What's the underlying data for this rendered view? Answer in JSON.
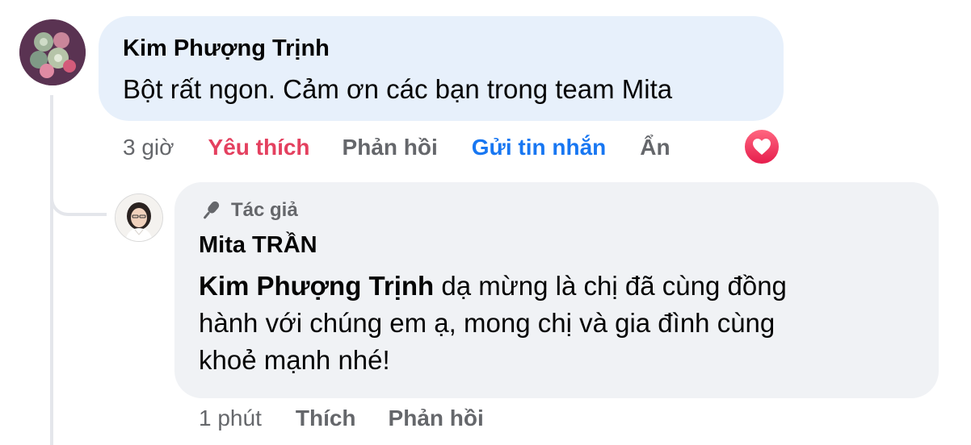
{
  "comment": {
    "author": "Kim Phượng Trịnh",
    "text": "Bột rất ngon. Cảm ơn các bạn trong team Mita",
    "time": "3 giờ",
    "actions": {
      "like": "Yêu thích",
      "reply": "Phản hồi",
      "message": "Gửi tin nhắn",
      "hide": "Ẩn"
    },
    "reaction_icon": "heart-icon",
    "colors": {
      "like": "#e4405f",
      "message": "#1877f2",
      "bubble": "#e7f0fb"
    }
  },
  "reply": {
    "badge": "Tác giả",
    "badge_icon": "microphone-icon",
    "author": "Mita TRẦN",
    "mention": "Kim Phượng Trịnh",
    "text_line1": " dạ mừng là chị đã cùng đồng",
    "text_line2": "hành với chúng em ạ, mong chị và gia đình cùng",
    "text_line3": "khoẻ mạnh nhé!",
    "time": "1 phút",
    "actions": {
      "like": "Thích",
      "reply": "Phản hồi"
    },
    "colors": {
      "bubble": "#f0f2f5"
    }
  }
}
